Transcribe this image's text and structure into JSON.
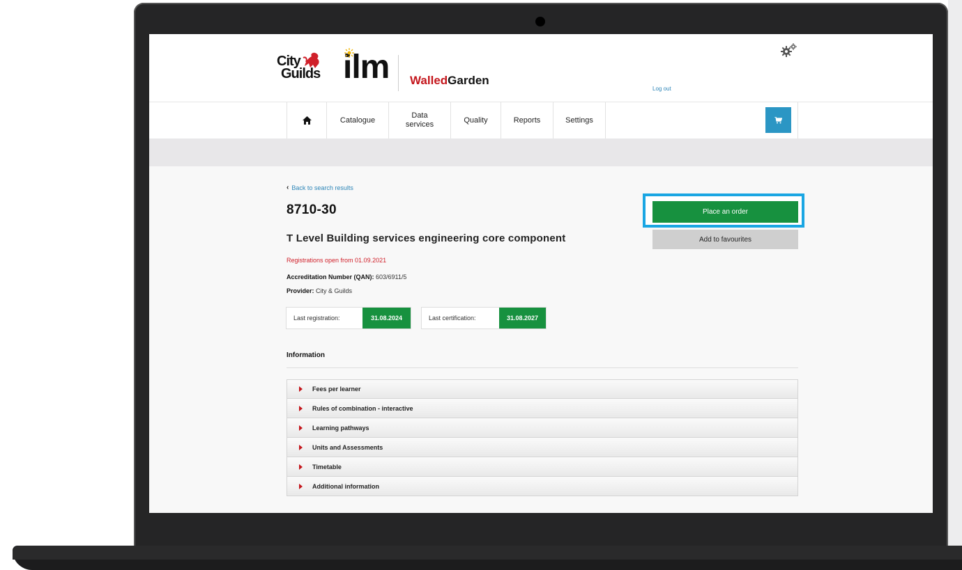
{
  "header": {
    "logo_city_line1": "City",
    "logo_city_line2": "Guilds",
    "logo_ilm": "ilm",
    "brand_part1": "Walled",
    "brand_part2": "Garden",
    "logout_label": "Log out",
    "settings_icon": "gears-icon"
  },
  "nav": {
    "home_icon": "home-icon",
    "items": [
      {
        "label": "Catalogue"
      },
      {
        "label": "Data services"
      },
      {
        "label": "Quality"
      },
      {
        "label": "Reports"
      },
      {
        "label": "Settings"
      }
    ],
    "cart_icon": "cart-icon"
  },
  "qualification": {
    "back_label": "Back to search results",
    "code": "8710-30",
    "title": "T Level Building services engineering core component",
    "registration_notice": "Registrations open from 01.09.2021",
    "accreditation_label": "Accreditation Number (QAN):",
    "accreditation_value": "603/6911/5",
    "provider_label": "Provider:",
    "provider_value": "City & Guilds",
    "last_registration_label": "Last registration:",
    "last_registration_value": "31.08.2024",
    "last_certification_label": "Last certification:",
    "last_certification_value": "31.08.2027"
  },
  "actions": {
    "place_order_label": "Place an order",
    "add_favourites_label": "Add to favourites"
  },
  "information": {
    "heading": "Information",
    "sections": [
      {
        "label": "Fees per learner"
      },
      {
        "label": "Rules of combination - interactive"
      },
      {
        "label": "Learning pathways"
      },
      {
        "label": "Units and Assessments"
      },
      {
        "label": "Timetable"
      },
      {
        "label": "Additional information"
      }
    ]
  },
  "colors": {
    "accent_green": "#17913f",
    "highlight_blue": "#1aa6e3",
    "brand_red": "#c4161c",
    "cart_blue": "#2b96c4"
  }
}
